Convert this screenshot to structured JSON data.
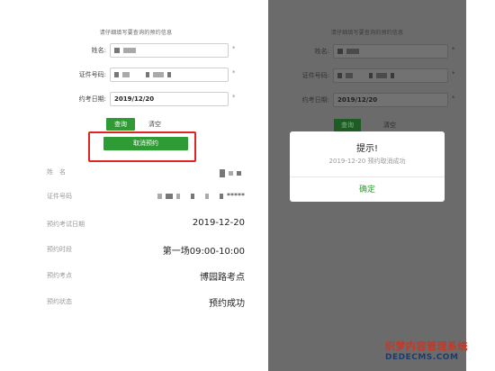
{
  "left": {
    "hint": "请仔细填写要查询的预约信息",
    "form": {
      "name_label": "姓名:",
      "id_label": "证件号码:",
      "date_label": "约考日期:",
      "date_value": "2019/12/20",
      "required_mark": "*"
    },
    "buttons": {
      "query": "查询",
      "clear": "清空",
      "cancel": "取消预约"
    },
    "info": {
      "name_key": "姓　名",
      "id_key": "证件号码",
      "id_suffix": "*****",
      "exam_date_key": "预约考试日期",
      "exam_date_value": "2019-12-20",
      "session_key": "预约时段",
      "session_value": "第一场09:00-10:00",
      "venue_key": "预约考点",
      "venue_value": "博园路考点",
      "status_key": "预约状态",
      "status_value": "预约成功"
    }
  },
  "right": {
    "hint": "请仔细填写要查询的预约信息",
    "form": {
      "name_label": "姓名:",
      "id_label": "证件号码:",
      "date_label": "约考日期:",
      "date_value": "2019/12/20",
      "required_mark": "*"
    },
    "buttons": {
      "query": "查询",
      "clear": "清空"
    },
    "dialog": {
      "title": "提示!",
      "message": "2019-12-20 预约取消成功",
      "ok": "确定"
    }
  },
  "watermark": {
    "line1": "织梦内容管理系统",
    "line2": "DEDECMS.COM"
  },
  "colors": {
    "primary_green": "#2e9b34",
    "highlight_red": "#e02424",
    "overlay_gray": "#6b6b6b"
  }
}
